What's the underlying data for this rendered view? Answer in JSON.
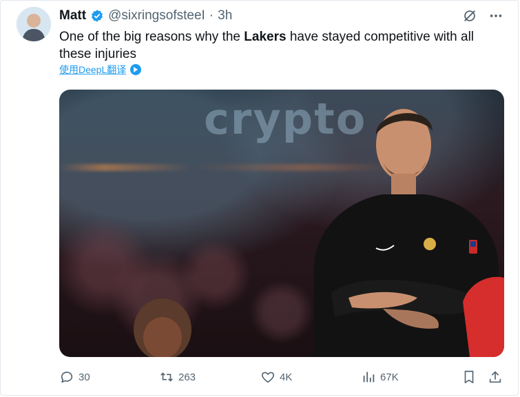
{
  "post": {
    "author_name": "Matt",
    "handle": "@sixringsofsteeI",
    "separator": "·",
    "time": "3h",
    "text_before": "One of the big reasons why the ",
    "text_bold": "Lakers",
    "text_after": " have stayed competitive with all these injuries",
    "translate_link": "使用DeepL翻译",
    "media_banner_text": "crypto"
  },
  "actions": {
    "replies": "30",
    "reposts": "263",
    "likes": "4K",
    "views": "67K"
  },
  "colors": {
    "accent": "#1d9bf0",
    "muted": "#536471",
    "text": "#0f1419"
  },
  "icons": {
    "verified": "verified-badge-icon",
    "grok": "grok-icon",
    "more": "more-icon",
    "reply": "reply-icon",
    "repost": "repost-icon",
    "like": "like-icon",
    "views": "views-icon",
    "bookmark": "bookmark-icon",
    "share": "share-icon"
  }
}
